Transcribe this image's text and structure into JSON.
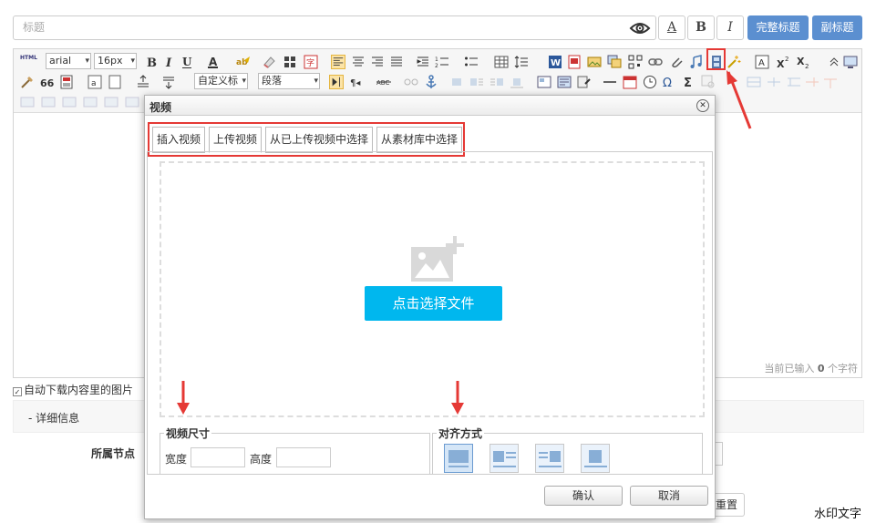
{
  "title_field": {
    "placeholder": "标题"
  },
  "title_toolbar": {
    "underline_a": "A",
    "bold_b": "B",
    "italic_i": "I",
    "full_title_button": "完整标题",
    "subtitle_button": "副标题"
  },
  "editor_toolbar": {
    "font_family": "arial",
    "font_size": "16px",
    "custom_title": "自定义标",
    "paragraph": "段落",
    "html_label": "HTML",
    "quote_label": "66"
  },
  "status_bar": {
    "prefix": "当前已输入",
    "count": "0",
    "suffix": "个字符"
  },
  "auto_download": {
    "label": "自动下载内容里的图片"
  },
  "detail_section": {
    "label": "- 详细信息"
  },
  "node_field": {
    "label": "所属节点"
  },
  "form_buttons": {
    "reset_peek": "重置"
  },
  "watermark": "水印文字",
  "video_dialog": {
    "title": "视频",
    "close_symbol": "✕",
    "tabs": [
      {
        "label": "插入视频"
      },
      {
        "label": "上传视频"
      },
      {
        "label": "从已上传视频中选择"
      },
      {
        "label": "从素材库中选择"
      }
    ],
    "choose_file_button": "点击选择文件",
    "size_section": {
      "legend": "视频尺寸",
      "width_label": "宽度",
      "height_label": "高度"
    },
    "align_section": {
      "legend": "对齐方式",
      "options": [
        "none",
        "left",
        "right",
        "center"
      ],
      "selected": "none"
    },
    "confirm_button": "确认",
    "cancel_button": "取消"
  },
  "colors": {
    "accent_blue": "#5b8fd0",
    "upload_button": "#00b7ee",
    "annotation_red": "#e53935"
  }
}
